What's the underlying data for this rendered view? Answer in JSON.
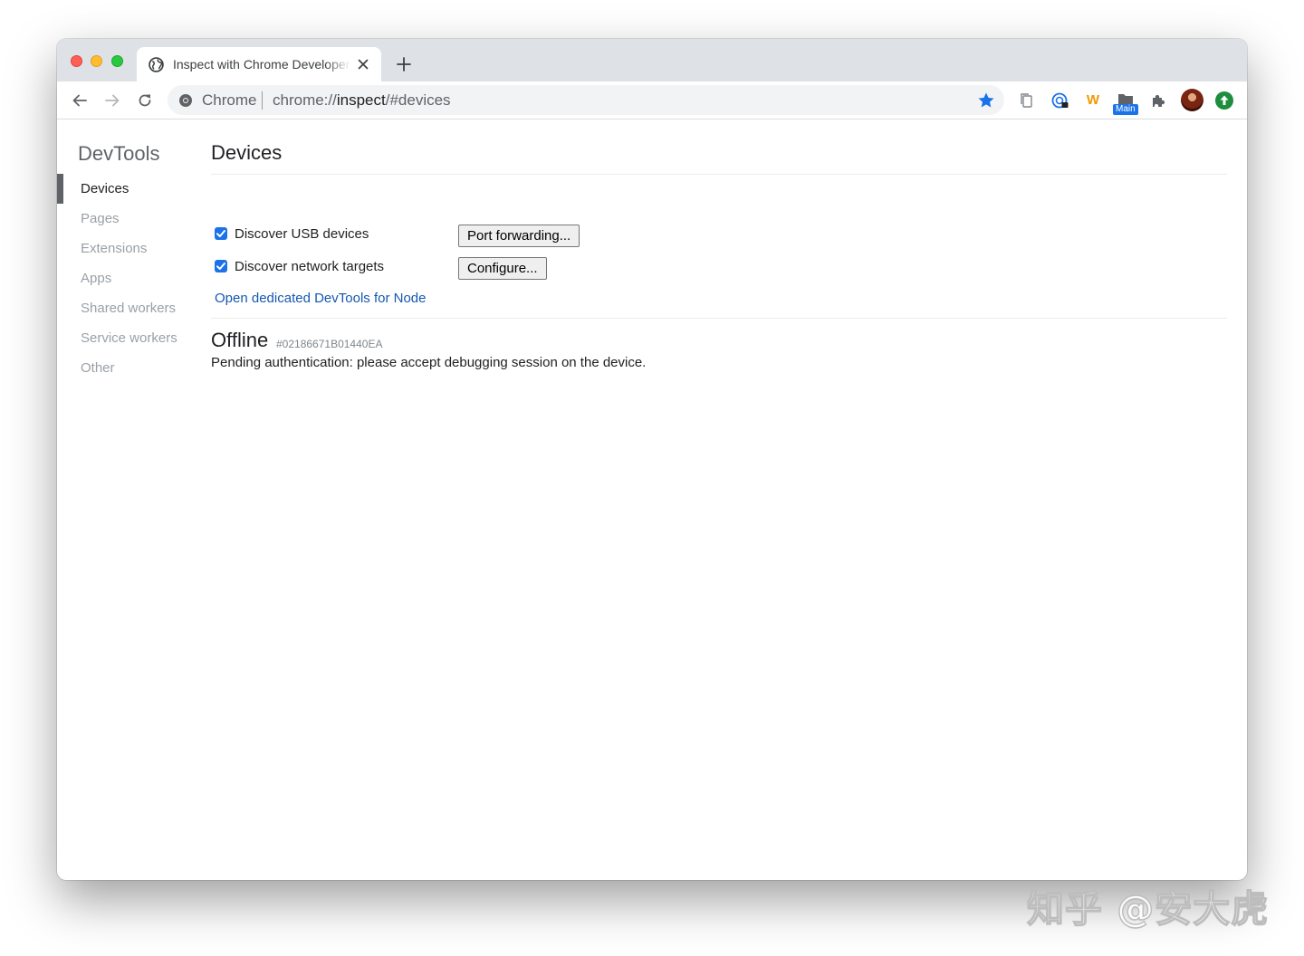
{
  "browser": {
    "tab": {
      "title": "Inspect with Chrome Developer Tools"
    },
    "omnibox": {
      "chip": "Chrome",
      "url_scheme": "chrome://",
      "url_host": "inspect",
      "url_path": "/#devices"
    },
    "extensions": {
      "main_label": "Main",
      "w_label": "W"
    }
  },
  "sidebar": {
    "title": "DevTools",
    "items": [
      {
        "label": "Devices",
        "selected": true
      },
      {
        "label": "Pages",
        "selected": false
      },
      {
        "label": "Extensions",
        "selected": false
      },
      {
        "label": "Apps",
        "selected": false
      },
      {
        "label": "Shared workers",
        "selected": false
      },
      {
        "label": "Service workers",
        "selected": false
      },
      {
        "label": "Other",
        "selected": false
      }
    ]
  },
  "main": {
    "title": "Devices",
    "discover_usb": {
      "label": "Discover USB devices",
      "checked": true
    },
    "discover_network": {
      "label": "Discover network targets",
      "checked": true
    },
    "port_forwarding_button": "Port forwarding...",
    "configure_button": "Configure...",
    "node_link": "Open dedicated DevTools for Node",
    "device": {
      "name": "Offline",
      "serial": "#02186671B01440EA",
      "status": "Pending authentication: please accept debugging session on the device."
    }
  },
  "watermark": "知乎 @安大虎",
  "colors": {
    "accent": "#1a73e8",
    "link": "#1558b0",
    "tabstrip": "#dee1e6",
    "omnibox": "#f1f3f4",
    "selected_bar": "#5f6368"
  }
}
